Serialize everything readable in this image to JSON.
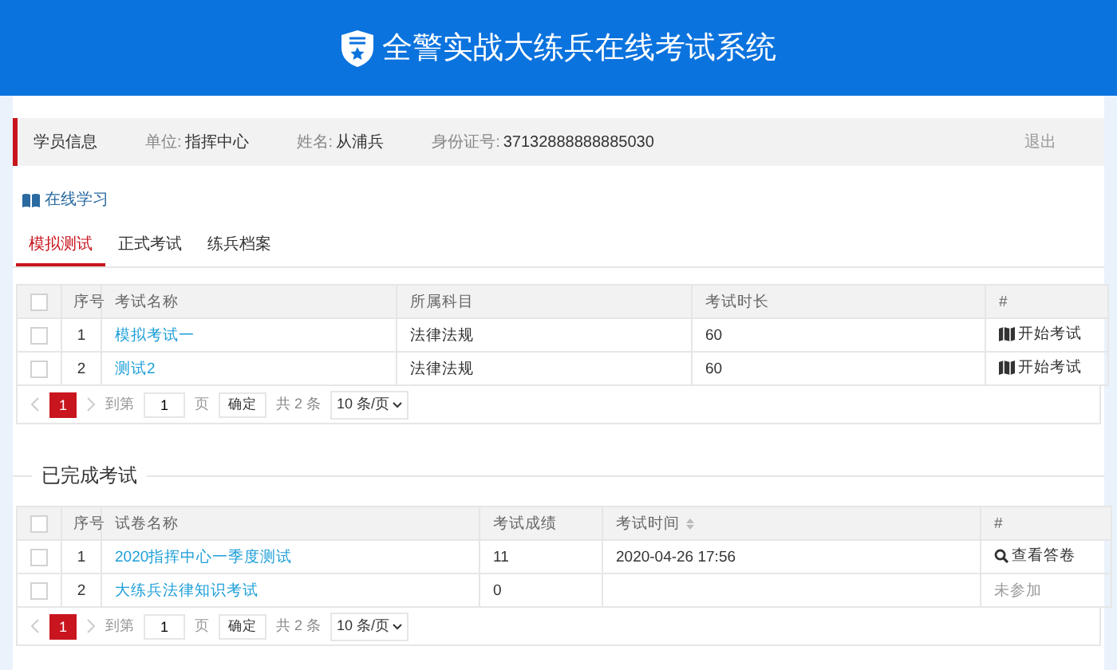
{
  "header": {
    "title": "全警实战大练兵在线考试系统"
  },
  "student_info": {
    "label": "学员信息",
    "fields": [
      {
        "label": "单位:",
        "value": "指挥中心"
      },
      {
        "label": "姓名:",
        "value": "从浦兵"
      },
      {
        "label": "身份证号:",
        "value": "37132888888885030"
      }
    ],
    "logout": "退出"
  },
  "online_study": {
    "label": "在线学习"
  },
  "tabs": [
    {
      "label": "模拟测试",
      "selected": true
    },
    {
      "label": "正式考试",
      "selected": false
    },
    {
      "label": "练兵档案",
      "selected": false
    }
  ],
  "sections": [
    {
      "columns": [
        {
          "label": "序号",
          "sortable": false
        },
        {
          "label": "考试名称",
          "sortable": false
        },
        {
          "label": "所属科目",
          "sortable": false
        },
        {
          "label": "考试时长",
          "sortable": false
        },
        {
          "label": "#",
          "sortable": false
        }
      ],
      "all_checked": false,
      "rows": [
        {
          "checked": false,
          "cells": [
            "1",
            "模拟考试一",
            "法律法规",
            "60"
          ],
          "action": {
            "kind": "start",
            "label": "开始考试"
          }
        },
        {
          "checked": false,
          "cells": [
            "2",
            "测试2",
            "法律法规",
            "60"
          ],
          "action": {
            "kind": "start",
            "label": "开始考试"
          }
        }
      ],
      "pagination": {
        "pages": [
          {
            "label": "1",
            "selected": true
          }
        ],
        "goto_label": "到第",
        "page_input": "1",
        "page_unit": "页",
        "confirm": "确定",
        "total": "共 2 条",
        "page_size": "10 条/页"
      }
    },
    {
      "title": "已完成考试",
      "columns": [
        {
          "label": "序号",
          "sortable": false
        },
        {
          "label": "试卷名称",
          "sortable": false
        },
        {
          "label": "考试成绩",
          "sortable": false
        },
        {
          "label": "考试时间",
          "sortable": true
        },
        {
          "label": "#",
          "sortable": false
        }
      ],
      "all_checked": false,
      "rows": [
        {
          "checked": false,
          "cells": [
            "1",
            "2020指挥中心一季度测试",
            "11",
            "2020-04-26 17:56"
          ],
          "action": {
            "kind": "view",
            "label": "查看答卷"
          }
        },
        {
          "checked": false,
          "cells": [
            "2",
            "大练兵法律知识考试",
            "0",
            ""
          ],
          "action": {
            "kind": "none",
            "label": "未参加"
          }
        }
      ],
      "pagination": {
        "pages": [
          {
            "label": "1",
            "selected": true
          }
        ],
        "goto_label": "到第",
        "page_input": "1",
        "page_unit": "页",
        "confirm": "确定",
        "total": "共 2 条",
        "page_size": "10 条/页"
      }
    }
  ]
}
